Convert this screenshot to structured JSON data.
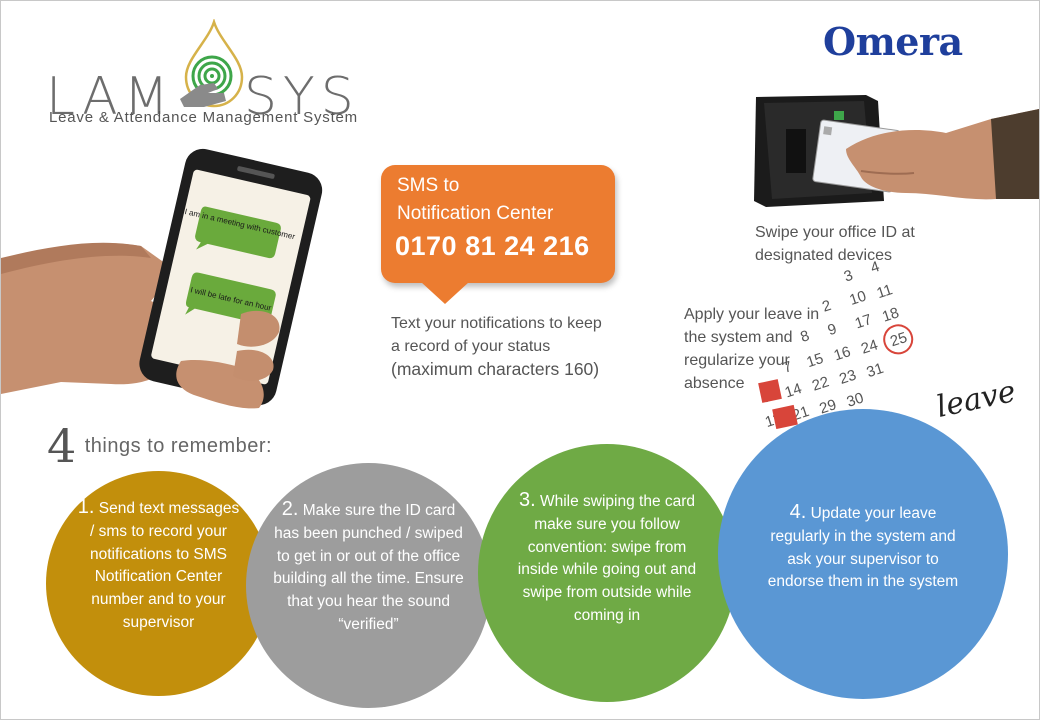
{
  "logo": {
    "left": "LAM",
    "right": "SYS",
    "tagline": "Leave & Attendance Management System",
    "icon": "droplet-fingerprint-icon"
  },
  "brand": {
    "name": "Omera",
    "color": "#1f3f9c"
  },
  "phone": {
    "msg1": "I am in a meeting with customer",
    "msg2": "I will be late for an hour"
  },
  "sms": {
    "line1": "SMS to",
    "line2": "Notification Center",
    "number": "0170 81 24 216",
    "note_line1": "Text your notifications to keep",
    "note_line2": "a record of your status",
    "note_line3": "(maximum characters 160)",
    "color": "#ec7c30"
  },
  "swipe": {
    "line1": "Swipe your office ID at",
    "line2": "designated devices"
  },
  "apply": {
    "line1": "Apply your leave in",
    "line2": "the system and",
    "line3": "regularize your",
    "line4": "absence",
    "calendar_word": "leave"
  },
  "heading": {
    "number": "4",
    "text": "things to remember:"
  },
  "tips": [
    {
      "num": "1.",
      "text": "Send text messages / sms to record your notifications to SMS Notification Center number and to your supervisor",
      "color": "#c28f0c"
    },
    {
      "num": "2.",
      "text": "Make sure the ID card has been punched / swiped to get in or out of the office building all the time. Ensure that you hear the sound “verified”",
      "color": "#9d9d9d"
    },
    {
      "num": "3.",
      "text": "While swiping the card make sure you follow convention: swipe from inside while going out and swipe from outside while coming in",
      "color": "#6faa45"
    },
    {
      "num": "4.",
      "text": "Update your leave regularly in the system and ask your supervisor to endorse them in the system",
      "color": "#5a97d4"
    }
  ]
}
